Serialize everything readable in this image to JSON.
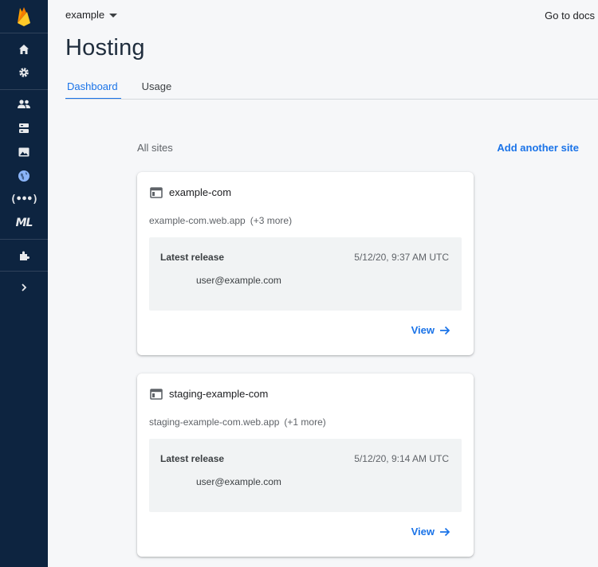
{
  "header": {
    "project": "example",
    "docs_link": "Go to docs",
    "title": "Hosting"
  },
  "tabs": [
    {
      "label": "Dashboard",
      "active": true
    },
    {
      "label": "Usage",
      "active": false
    }
  ],
  "sidebar": {
    "items": [
      {
        "icon": "home-icon"
      },
      {
        "icon": "settings-gear-icon"
      },
      {
        "icon": "users-icon"
      },
      {
        "icon": "database-icon"
      },
      {
        "icon": "image-icon"
      },
      {
        "icon": "globe-icon",
        "active": true
      },
      {
        "icon": "functions-icon",
        "text": "(•••)"
      },
      {
        "icon": "ml-icon",
        "text": "ML"
      },
      {
        "icon": "extensions-icon"
      },
      {
        "icon": "chevron-right-icon"
      }
    ]
  },
  "content": {
    "section_label": "All sites",
    "add_site_label": "Add another site",
    "sites": [
      {
        "name": "example-com",
        "domain": "example-com.web.app",
        "more": "(+3 more)",
        "release_label": "Latest release",
        "release_time": "5/12/20, 9:37 AM UTC",
        "release_user": "user@example.com",
        "view_label": "View"
      },
      {
        "name": "staging-example-com",
        "domain": "staging-example-com.web.app",
        "more": "(+1 more)",
        "release_label": "Latest release",
        "release_time": "5/12/20, 9:14 AM UTC",
        "release_user": "user@example.com",
        "view_label": "View"
      }
    ]
  },
  "colors": {
    "sidebar_bg": "#0d2440",
    "accent": "#1a73e8",
    "page_bg": "#f6f7f9",
    "release_box_bg": "#f1f3f4",
    "firebase_yellow": "#ffca28",
    "firebase_orange": "#f57c00",
    "active_globe": "#8ab4f8"
  }
}
